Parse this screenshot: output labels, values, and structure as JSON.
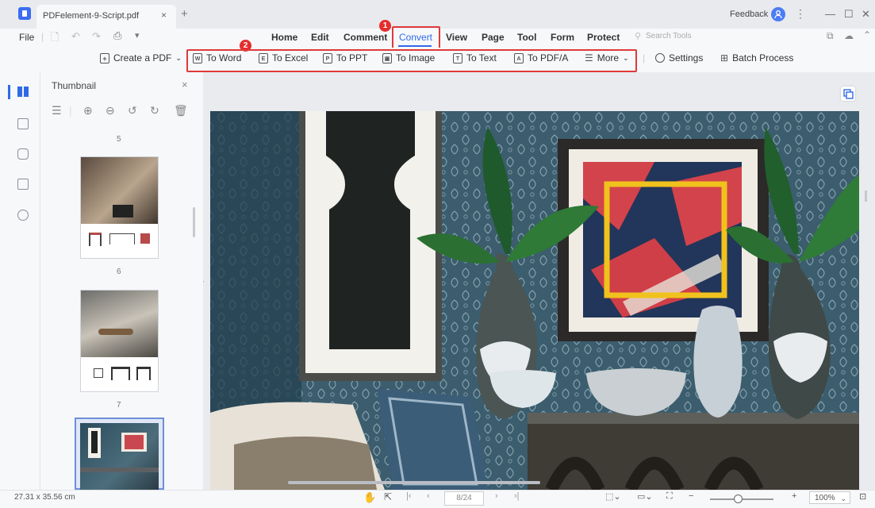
{
  "titlebar": {
    "tab_title": "PDFelement-9-Script.pdf",
    "tab_close": "×",
    "new_tab": "+",
    "feedback": "Feedback",
    "kebab": "⋮",
    "minimize": "—",
    "maximize": "☐",
    "close": "✕"
  },
  "menubar": {
    "file": "File",
    "items": [
      "Home",
      "Edit",
      "Comment",
      "Convert",
      "View",
      "Page",
      "Tool",
      "Form",
      "Protect"
    ],
    "search_placeholder": "Search Tools",
    "active": "Convert"
  },
  "callouts": {
    "one": "1",
    "two": "2"
  },
  "toolbar": {
    "create_pdf": "Create a PDF",
    "to_word": "To Word",
    "to_excel": "To Excel",
    "to_ppt": "To PPT",
    "to_image": "To Image",
    "to_text": "To Text",
    "to_pdfa": "To PDF/A",
    "more": "More",
    "settings": "Settings",
    "batch_process": "Batch Process",
    "icon_letters": {
      "word": "W",
      "excel": "E",
      "ppt": "P",
      "image": "▣",
      "text": "T",
      "pdfa": "A"
    }
  },
  "thumbnail_panel": {
    "title": "Thumbnail",
    "close": "×",
    "pages": [
      "5",
      "6",
      "7"
    ]
  },
  "statusbar": {
    "dimensions": "27.31 x 35.56 cm",
    "page_field": "8/24",
    "zoom": "100%",
    "zoom_minus": "−",
    "zoom_plus": "+"
  },
  "colors": {
    "accent": "#2f6ae8",
    "callout_red": "#e03a3a",
    "badge_red": "#e52d2d",
    "wallpaper": "#35586c"
  }
}
